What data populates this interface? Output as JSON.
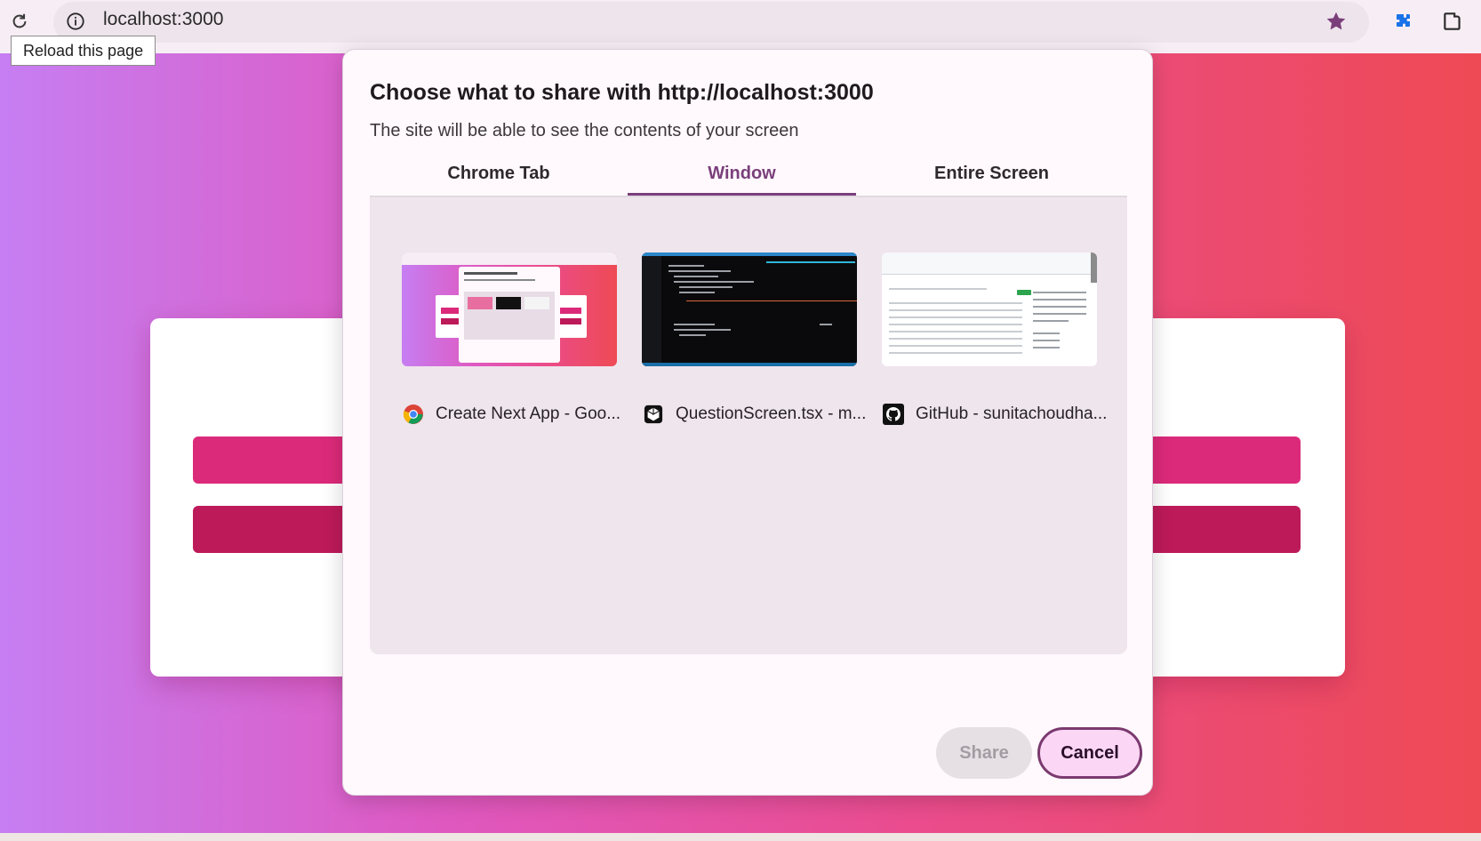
{
  "browser": {
    "url": "localhost:3000",
    "reload_tooltip": "Reload this page",
    "icons": [
      "reload-icon",
      "site-info-icon",
      "bookmark-star-icon",
      "extensions-puzzle-icon",
      "side-panel-icon"
    ],
    "accent_color": "#7a3f7b"
  },
  "dialog": {
    "title": "Choose what to share with http://localhost:3000",
    "subtitle": "The site will be able to see the contents of your screen",
    "tabs": [
      {
        "label": "Chrome Tab",
        "selected": false
      },
      {
        "label": "Window",
        "selected": true
      },
      {
        "label": "Entire Screen",
        "selected": false
      }
    ],
    "windows": [
      {
        "label": "Create Next App - Goo...",
        "icon": "chrome-icon"
      },
      {
        "label": "QuestionScreen.tsx - m...",
        "icon": "cursor-editor-icon"
      },
      {
        "label": "GitHub - sunitachoudha...",
        "icon": "github-icon"
      }
    ],
    "share_label": "Share",
    "cancel_label": "Cancel"
  }
}
